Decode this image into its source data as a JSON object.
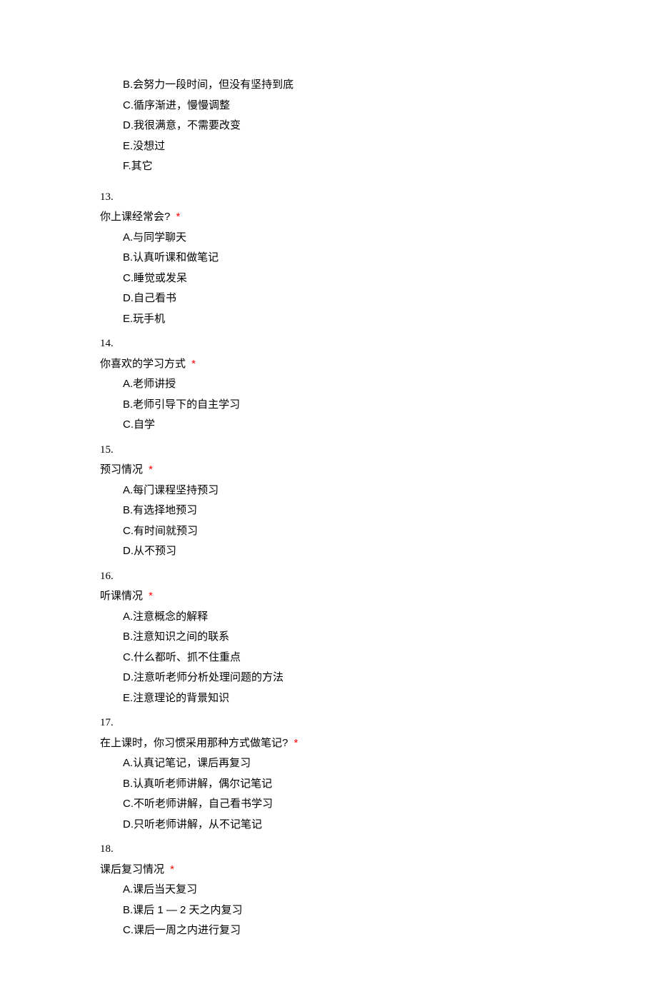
{
  "required_mark": "*",
  "top_options": [
    "B.会努力一段时间，但没有坚持到底",
    "C.循序渐进，慢慢调整",
    "D.我很满意，不需要改变",
    "E.没想过",
    "F.其它"
  ],
  "questions": [
    {
      "num": "13.",
      "title": "你上课经常会? ",
      "options": [
        "A.与同学聊天",
        "B.认真听课和做笔记",
        "C.睡觉或发呆",
        "D.自己看书",
        "E.玩手机"
      ]
    },
    {
      "num": "14.",
      "title": "你喜欢的学习方式 ",
      "options": [
        "A.老师讲授",
        "B.老师引导下的自主学习",
        "C.自学"
      ]
    },
    {
      "num": "15.",
      "title": "预习情况 ",
      "options": [
        "A.每门课程坚持预习",
        "B.有选择地预习",
        "C.有时间就预习",
        "D.从不预习"
      ]
    },
    {
      "num": "16.",
      "title": "听课情况 ",
      "options": [
        "A.注意概念的解释",
        "B.注意知识之间的联系",
        "C.什么都听、抓不住重点",
        "D.注意听老师分析处理问题的方法",
        "E.注意理论的背景知识"
      ]
    },
    {
      "num": "17.",
      "title": "在上课时，你习惯采用那种方式做笔记? ",
      "options": [
        "A.认真记笔记，课后再复习",
        "B.认真听老师讲解，偶尔记笔记",
        "C.不听老师讲解，自己看书学习",
        "D.只听老师讲解，从不记笔记"
      ]
    },
    {
      "num": "18.",
      "title": "课后复习情况 ",
      "options": [
        "A.课后当天复习",
        "B.课后 1 — 2 天之内复习",
        "C.课后一周之内进行复习"
      ]
    }
  ]
}
